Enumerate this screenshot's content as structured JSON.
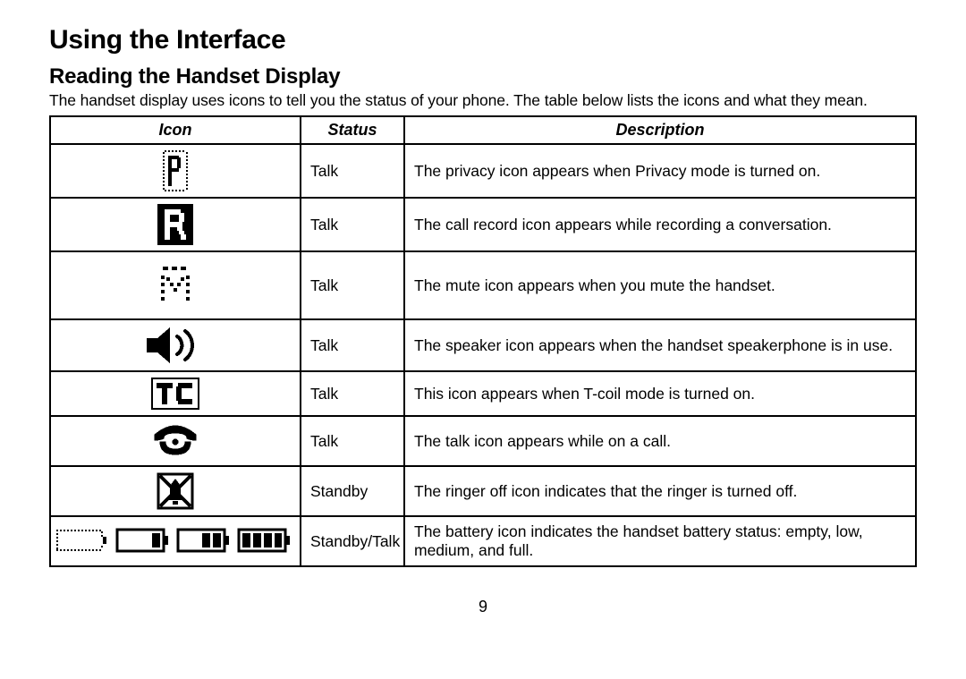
{
  "title": "Using the Interface",
  "subtitle": "Reading the Handset Display",
  "intro": "The handset display uses icons to tell you the status of your phone. The table below lists the icons and what they mean.",
  "headers": {
    "icon": "Icon",
    "status": "Status",
    "description": "Description"
  },
  "rows": [
    {
      "icon": "privacy-icon",
      "status": "Talk",
      "description": "The privacy icon appears when Privacy mode is turned on."
    },
    {
      "icon": "record-icon",
      "status": "Talk",
      "description": "The call record icon appears while recording a conversation."
    },
    {
      "icon": "mute-icon",
      "status": "Talk",
      "description": "The mute icon appears when you mute the handset."
    },
    {
      "icon": "speaker-icon",
      "status": "Talk",
      "description": "The speaker icon appears when the handset speakerphone is in use."
    },
    {
      "icon": "tcoil-icon",
      "status": "Talk",
      "description": "This icon appears when T-coil mode is turned on."
    },
    {
      "icon": "talk-icon",
      "status": "Talk",
      "description": "The talk icon appears while on a call."
    },
    {
      "icon": "ringer-off-icon",
      "status": "Standby",
      "description": "The ringer off icon indicates that the ringer is turned off."
    },
    {
      "icon": "battery-icon",
      "status": "Standby/Talk",
      "description": "The battery icon indicates the handset battery status: empty, low, medium, and full."
    }
  ],
  "page_number": "9"
}
